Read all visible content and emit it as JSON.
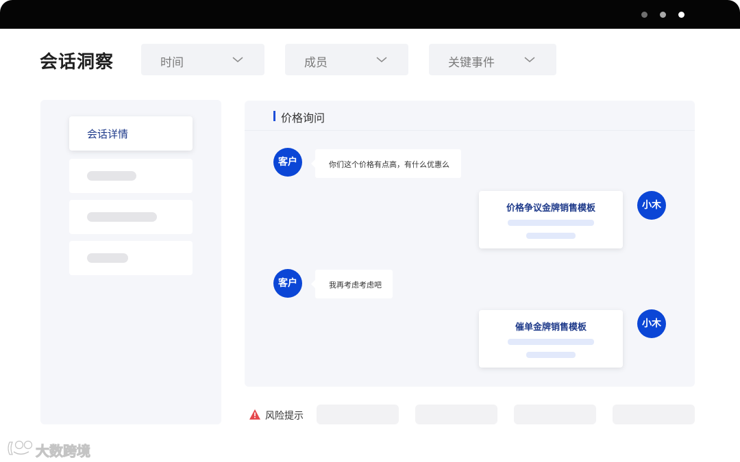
{
  "window": {
    "controls": [
      "dot-dark",
      "dot-gray",
      "dot-white"
    ]
  },
  "page": {
    "title": "会话洞察"
  },
  "filters": [
    {
      "label": "时间",
      "icon": "chevron-down-icon"
    },
    {
      "label": "成员",
      "icon": "chevron-down-icon"
    },
    {
      "label": "关键事件",
      "icon": "chevron-down-icon"
    }
  ],
  "sidebar": {
    "items": [
      {
        "label": "会话详情",
        "active": true
      },
      {
        "label": "",
        "placeholder": true
      },
      {
        "label": "",
        "placeholder": true
      },
      {
        "label": "",
        "placeholder": true
      }
    ]
  },
  "chat": {
    "header": "价格询问",
    "messages": [
      {
        "role": "customer",
        "avatar": "客户",
        "text": "你们这个价格有点高，有什么优惠么"
      },
      {
        "role": "agent",
        "avatar": "小木",
        "card_title": "价格争议金牌销售模板"
      },
      {
        "role": "customer",
        "avatar": "客户",
        "text": "我再考虑考虑吧"
      },
      {
        "role": "agent",
        "avatar": "小木",
        "card_title": "催单金牌销售模板"
      }
    ]
  },
  "risk": {
    "label": "风险提示",
    "icon": "warning-icon",
    "pill_count": 4
  },
  "watermark": {
    "text": "大数跨境"
  },
  "colors": {
    "accent": "#0b46d6",
    "card_title": "#1e3a8a",
    "panel_bg": "#f5f6fa",
    "warning": "#e5484d"
  }
}
